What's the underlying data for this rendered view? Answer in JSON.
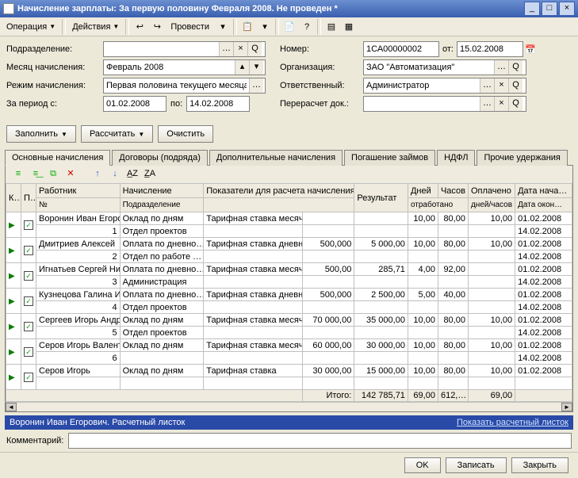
{
  "window": {
    "title": "Начисление зарплаты: За первую половину Февраля 2008. Не проведен *",
    "min": "_",
    "max": "□",
    "close": "×"
  },
  "menubar": {
    "operation": "Операция",
    "actions": "Действия",
    "post": "Провести"
  },
  "form": {
    "podrazdelenie_lbl": "Подразделение:",
    "podrazdelenie_val": "",
    "month_lbl": "Месяц начисления:",
    "month_val": "Февраль 2008",
    "mode_lbl": "Режим начисления:",
    "mode_val": "Первая половина текущего месяца",
    "period_lbl": "За период с:",
    "period_from": "01.02.2008",
    "period_to_lbl": "по:",
    "period_to": "14.02.2008",
    "number_lbl": "Номер:",
    "number_val": "1СА00000002",
    "ot_lbl": "от:",
    "ot_val": "15.02.2008",
    "org_lbl": "Организация:",
    "org_val": "ЗАО \"Автоматизация\"",
    "resp_lbl": "Ответственный:",
    "resp_val": "Администратор",
    "recalc_lbl": "Перерасчет док.:",
    "recalc_val": ""
  },
  "actions": {
    "fill": "Заполнить",
    "calc": "Рассчитать",
    "clear": "Очистить"
  },
  "tabs": [
    "Основные начисления",
    "Договоры (подряда)",
    "Дополнительные начисления",
    "Погашение займов",
    "НДФЛ",
    "Прочие удержания"
  ],
  "grid": {
    "headers": {
      "k": "К…",
      "p": "П…",
      "employee": "Работник",
      "accrual": "Начисление",
      "indicators": "Показатели для расчета начисления",
      "result": "Результат",
      "days": "Дней",
      "hours": "Часов",
      "worked": "отработано",
      "paid": "Оплачено",
      "paid_sub": "дней/часов",
      "date_from": "Дата нача…",
      "date_to": "Дата окон…",
      "no": "№",
      "podr": "Подразделение"
    },
    "rows": [
      {
        "n": "1",
        "emp": "Воронин Иван Егорович",
        "podr": "Отдел проектов",
        "acc": "Оклад по дням",
        "acc2": "",
        "ind": "Тарифная ставка месячная",
        "val": "",
        "res": "",
        "d": "10,00",
        "h": "80,00",
        "paid": "10,00",
        "df": "01.02.2008",
        "dt": "14.02.2008"
      },
      {
        "n": "2",
        "emp": "Дмитриев Алексей",
        "podr": "Отдел по работе …",
        "acc": "Оплата по дневно…",
        "acc2": "",
        "ind": "Тарифная ставка дневная",
        "val": "500,000",
        "res": "5 000,00",
        "d": "10,00",
        "h": "80,00",
        "paid": "10,00",
        "df": "01.02.2008",
        "dt": "14.02.2008"
      },
      {
        "n": "3",
        "emp": "Игнатьев Сергей Николаевич",
        "podr": "Администрация",
        "acc": "Оплата по дневно…",
        "acc2": "",
        "ind": "Тарифная ставка месячная",
        "val": "500,00",
        "res": "285,71",
        "d": "4,00",
        "h": "92,00",
        "paid": "",
        "df": "01.02.2008",
        "dt": "14.02.2008"
      },
      {
        "n": "4",
        "emp": "Кузнецова Галина Ивановна",
        "podr": "Отдел проектов",
        "acc": "Оплата по дневно…",
        "acc2": "",
        "ind": "Тарифная ставка дневная",
        "val": "500,000",
        "res": "2 500,00",
        "d": "5,00",
        "h": "40,00",
        "paid": "",
        "df": "01.02.2008",
        "dt": "14.02.2008"
      },
      {
        "n": "5",
        "emp": "Сергеев Игорь Андреевич",
        "podr": "Отдел проектов",
        "acc": "Оклад по дням",
        "acc2": "",
        "ind": "Тарифная ставка месячная",
        "val": "70 000,00",
        "res": "35 000,00",
        "d": "10,00",
        "h": "80,00",
        "paid": "10,00",
        "df": "01.02.2008",
        "dt": "14.02.2008"
      },
      {
        "n": "6",
        "emp": "Серов Игорь Валентинович",
        "podr": "",
        "acc": "Оклад по дням",
        "acc2": "",
        "ind": "Тарифная ставка месячная",
        "val": "60 000,00",
        "res": "30 000,00",
        "d": "10,00",
        "h": "80,00",
        "paid": "10,00",
        "df": "01.02.2008",
        "dt": "14.02.2008"
      },
      {
        "n": "",
        "emp": "Серов Игорь",
        "podr": "",
        "acc": "Оклад по дням",
        "acc2": "",
        "ind": "Тарифная ставка",
        "val": "30 000,00",
        "res": "15 000,00",
        "d": "10,00",
        "h": "80,00",
        "paid": "10,00",
        "df": "01.02.2008",
        "dt": ""
      }
    ],
    "total_lbl": "Итого:",
    "total_res": "142 785,71",
    "total_d": "69,00",
    "total_h": "612,…",
    "total_paid": "69,00"
  },
  "bluebar": {
    "left": "Воронин Иван Егорович. Расчетный листок",
    "right": "Показать расчетный листок"
  },
  "comment_lbl": "Комментарий:",
  "comment_val": "",
  "footer": {
    "ok": "OK",
    "save": "Записать",
    "close": "Закрыть"
  }
}
